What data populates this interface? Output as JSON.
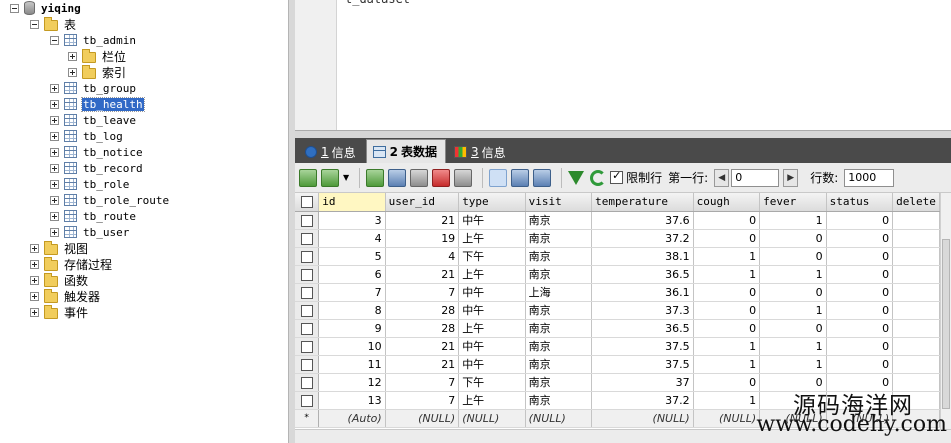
{
  "tree": {
    "db": "yiqing",
    "tables_folder": "表",
    "tb_admin_children": [
      "栏位",
      "索引"
    ],
    "tables": [
      "tb_admin",
      "tb_group",
      "tb_health",
      "tb_leave",
      "tb_log",
      "tb_notice",
      "tb_record",
      "tb_role",
      "tb_role_route",
      "tb_route",
      "tb_user"
    ],
    "selected": "tb_health",
    "other_folders": [
      "视图",
      "存储过程",
      "函数",
      "触发器",
      "事件"
    ]
  },
  "editor": {
    "visible_text": "t_dataset"
  },
  "tabs": [
    {
      "num": "1",
      "label": "信息",
      "icon": "info-icon"
    },
    {
      "num": "2",
      "label": "表数据",
      "icon": "table-data-icon",
      "active": true
    },
    {
      "num": "3",
      "label": "信息",
      "icon": "multi-info-icon"
    }
  ],
  "toolbar": {
    "limit_label": "限制行",
    "limit_checked": true,
    "first_row_label": "第一行:",
    "first_row_value": "0",
    "rows_label": "行数:",
    "rows_value": "1000"
  },
  "grid": {
    "columns": [
      "id",
      "user_id",
      "type",
      "visit",
      "temperature",
      "cough",
      "fever",
      "status",
      "delete"
    ],
    "rows": [
      [
        "3",
        "21",
        "中午",
        "南京",
        "37.6",
        "0",
        "1",
        "0"
      ],
      [
        "4",
        "19",
        "上午",
        "南京",
        "37.2",
        "0",
        "0",
        "0"
      ],
      [
        "5",
        "4",
        "下午",
        "南京",
        "38.1",
        "1",
        "0",
        "0"
      ],
      [
        "6",
        "21",
        "上午",
        "南京",
        "36.5",
        "1",
        "1",
        "0"
      ],
      [
        "7",
        "7",
        "中午",
        "上海",
        "36.1",
        "0",
        "0",
        "0"
      ],
      [
        "8",
        "28",
        "中午",
        "南京",
        "37.3",
        "0",
        "1",
        "0"
      ],
      [
        "9",
        "28",
        "上午",
        "南京",
        "36.5",
        "0",
        "0",
        "0"
      ],
      [
        "10",
        "21",
        "中午",
        "南京",
        "37.5",
        "1",
        "1",
        "0"
      ],
      [
        "11",
        "21",
        "中午",
        "南京",
        "37.5",
        "1",
        "1",
        "0"
      ],
      [
        "12",
        "7",
        "下午",
        "南京",
        "37",
        "0",
        "0",
        "0"
      ],
      [
        "13",
        "7",
        "上午",
        "南京",
        "37.2",
        "1",
        "",
        ""
      ]
    ],
    "new_row": {
      "marker": "*",
      "auto": "(Auto)",
      "null": "(NULL)"
    }
  },
  "watermark": {
    "line1": "源码海洋网",
    "line2": "www.codehy.com"
  },
  "colors": {
    "selection": "#3169c6",
    "tab_bar": "#4a4a4a",
    "current_header": "#fff7c2"
  }
}
